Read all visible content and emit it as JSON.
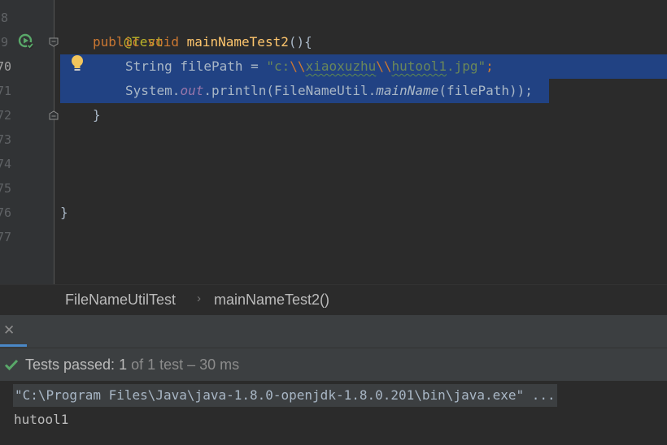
{
  "editor": {
    "line_numbers": [
      "8",
      "9",
      "70",
      "71",
      "72",
      "73",
      "74",
      "75",
      "76",
      "77"
    ],
    "lines": {
      "l1_annotation": "@Test",
      "l2_kw1": "public",
      "l2_kw2": "void",
      "l2_method": "mainNameTest2",
      "l2_rest": "(){",
      "l3_type": "String filePath = ",
      "l3_str_a": "\"c:",
      "l3_esc1": "\\\\",
      "l3_word1": "xiaoxuzhu",
      "l3_esc2": "\\\\",
      "l3_word2": "hutool1",
      "l3_str_b": ".jpg\"",
      "l3_semi": ";",
      "l4_a": "System.",
      "l4_field": "out",
      "l4_b": ".println(FileNameUtil.",
      "l4_static": "mainName",
      "l4_c": "(filePath));",
      "l5_brace": "}",
      "l9_brace": "}"
    },
    "icons": [
      "run-test-icon",
      "bulb-icon",
      "fold-icon"
    ]
  },
  "breadcrumb": {
    "class_name": "FileNameUtilTest",
    "separator": "›",
    "method_name": "mainNameTest2()"
  },
  "run_panel": {
    "close_glyph": "✕",
    "status_label": "Tests passed: ",
    "passed_count": "1",
    "status_rest": " of 1 test – 30 ms",
    "command": "\"C:\\Program Files\\Java\\java-1.8.0-openjdk-1.8.0.201\\bin\\java.exe\" ...",
    "output": "hutool1"
  },
  "colors": {
    "keyword": "#cc7832",
    "annotation": "#bbb529",
    "method": "#ffc66d",
    "string": "#6a8759",
    "field": "#9876aa",
    "selection": "#214283",
    "pass_green": "#59a869"
  }
}
